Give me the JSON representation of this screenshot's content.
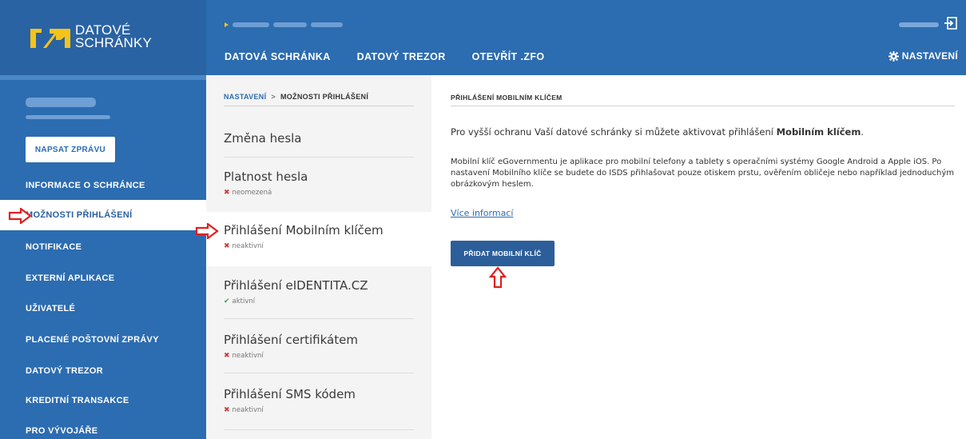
{
  "header": {
    "logo_line1": "DATOVÉ",
    "logo_line2": "SCHRÁNKY",
    "nav": [
      "DATOVÁ SCHRÁNKA",
      "DATOVÝ TREZOR",
      "OTEVŘÍT .ZFO"
    ],
    "settings_label": "NASTAVENÍ",
    "brand_yellow": "#f4c41a",
    "brand_blue": "#2c6cb0"
  },
  "sidebar": {
    "write_button": "NAPSAT ZPRÁVU",
    "items": [
      "INFORMACE O SCHRÁNCE",
      "MOŽNOSTI PŘIHLÁŠENÍ",
      "NOTIFIKACE",
      "EXTERNÍ APLIKACE",
      "UŽIVATELÉ",
      "PLACENÉ POŠTOVNÍ ZPRÁVY",
      "DATOVÝ TREZOR",
      "KREDITNÍ TRANSAKCE",
      "PRO VÝVOJÁŘE"
    ],
    "active_index": 1
  },
  "middle": {
    "breadcrumb_link": "NASTAVENÍ",
    "breadcrumb_sep": ">",
    "breadcrumb_current": "MOŽNOSTI PŘIHLÁŠENÍ",
    "options": [
      {
        "title": "Změna hesla",
        "status": ""
      },
      {
        "title": "Platnost hesla",
        "status": "neomezená"
      },
      {
        "title": "Přihlášení Mobilním klíčem",
        "status": "neaktivní"
      },
      {
        "title": "Přihlášení eIDENTITA.CZ",
        "status": "aktivní"
      },
      {
        "title": "Přihlášení certifikátem",
        "status": "neaktivní"
      },
      {
        "title": "Přihlášení SMS kódem",
        "status": "neaktivní"
      }
    ]
  },
  "content": {
    "title": "PŘIHLÁŠENÍ MOBILNÍM KLÍČEM",
    "para1_prefix": "Pro vyšší ochranu Vaší datové schránky si můžete aktivovat přihlášení ",
    "para1_bold": "Mobilním klíčem",
    "para1_suffix": ".",
    "para2": "Mobilní klíč eGovernmentu je aplikace pro mobilní telefony a tablety s operačními systémy Google Android a Apple iOS. Po nastavení Mobilního klíče se budete do ISDS přihlašovat pouze otiskem prstu, ověřením obličeje nebo například jednoduchým obrázkovým heslem.",
    "more_link": "Více informací",
    "add_button": "PŘIDAT MOBILNÍ KLÍČ"
  },
  "annotation_color": "#e02020"
}
